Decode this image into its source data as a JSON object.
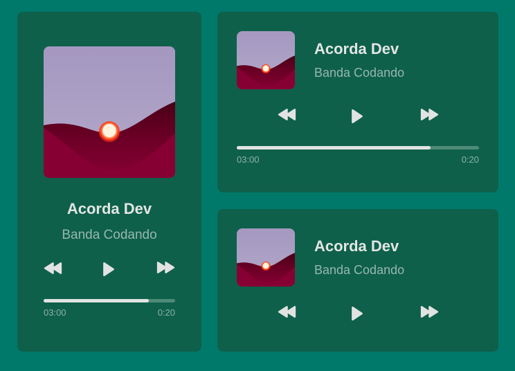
{
  "players": [
    {
      "title": "Acorda Dev",
      "artist": "Banda Codando",
      "progress": 0.8,
      "time_elapsed": "03:00",
      "time_total": "0:20",
      "controls": [
        "rewind-icon",
        "play-icon",
        "fast-forward-icon"
      ]
    },
    {
      "title": "Acorda Dev",
      "artist": "Banda Codando",
      "progress": 0.8,
      "time_elapsed": "03:00",
      "time_total": "0:20",
      "controls": [
        "rewind-icon",
        "play-icon",
        "fast-forward-icon"
      ]
    },
    {
      "title": "Acorda Dev",
      "artist": "Banda Codando",
      "controls": [
        "rewind-icon",
        "play-icon",
        "fast-forward-icon"
      ]
    }
  ],
  "colors": {
    "background": "#00796b",
    "card": "#0e604a",
    "progress_fill": "#e1e3e2",
    "progress_track": "#4f8a78",
    "art_sky": "#ab9fc2",
    "art_hill": "#7a0230",
    "art_sun": "#ff3a1a"
  }
}
